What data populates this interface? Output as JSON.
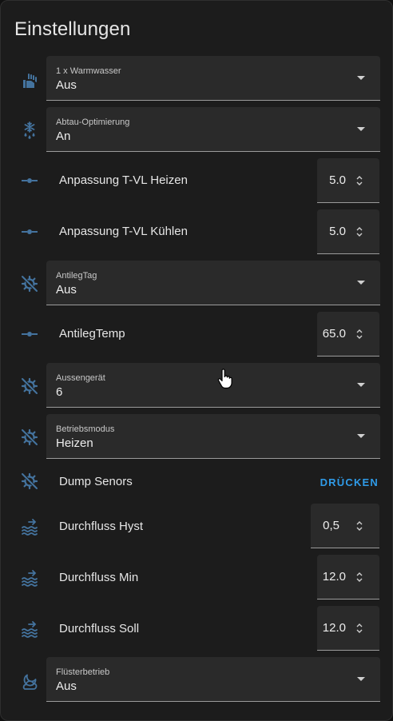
{
  "title": "Einstellungen",
  "colors": {
    "icon": "#44739e",
    "accent": "#2f9be8",
    "card": "#1c1c1c",
    "field": "#2a2a2a"
  },
  "rows": [
    {
      "type": "select",
      "icon": "hand-water-icon",
      "label": "1 x Warmwasser",
      "value": "Aus"
    },
    {
      "type": "select",
      "icon": "snowflake-melt-icon",
      "label": "Abtau-Optimierung",
      "value": "An"
    },
    {
      "type": "number",
      "icon": "ray-vertex-icon",
      "label": "Anpassung T-VL Heizen",
      "value": "5.0"
    },
    {
      "type": "number",
      "icon": "ray-vertex-icon",
      "label": "Anpassung T-VL Kühlen",
      "value": "5.0"
    },
    {
      "type": "select",
      "icon": "cog-off-icon",
      "label": "AntilegTag",
      "value": "Aus"
    },
    {
      "type": "number",
      "icon": "ray-vertex-icon",
      "label": "AntilegTemp",
      "value": "65.0"
    },
    {
      "type": "select",
      "icon": "cog-off-icon",
      "label": "Aussengerät",
      "value": "6"
    },
    {
      "type": "select",
      "icon": "cog-off-icon",
      "label": "Betriebsmodus",
      "value": "Heizen"
    },
    {
      "type": "button",
      "icon": "cog-off-icon",
      "label": "Dump Senors",
      "action": "DRÜCKEN"
    },
    {
      "type": "number",
      "icon": "water-flow-icon",
      "label": "Durchfluss Hyst",
      "value": "0,5"
    },
    {
      "type": "number",
      "icon": "water-flow-icon",
      "label": "Durchfluss Min",
      "value": "12.0"
    },
    {
      "type": "number",
      "icon": "water-flow-icon",
      "label": "Durchfluss Soll",
      "value": "12.0"
    },
    {
      "type": "select",
      "icon": "weather-night-icon",
      "label": "Flüsterbetrieb",
      "value": "Aus"
    }
  ]
}
